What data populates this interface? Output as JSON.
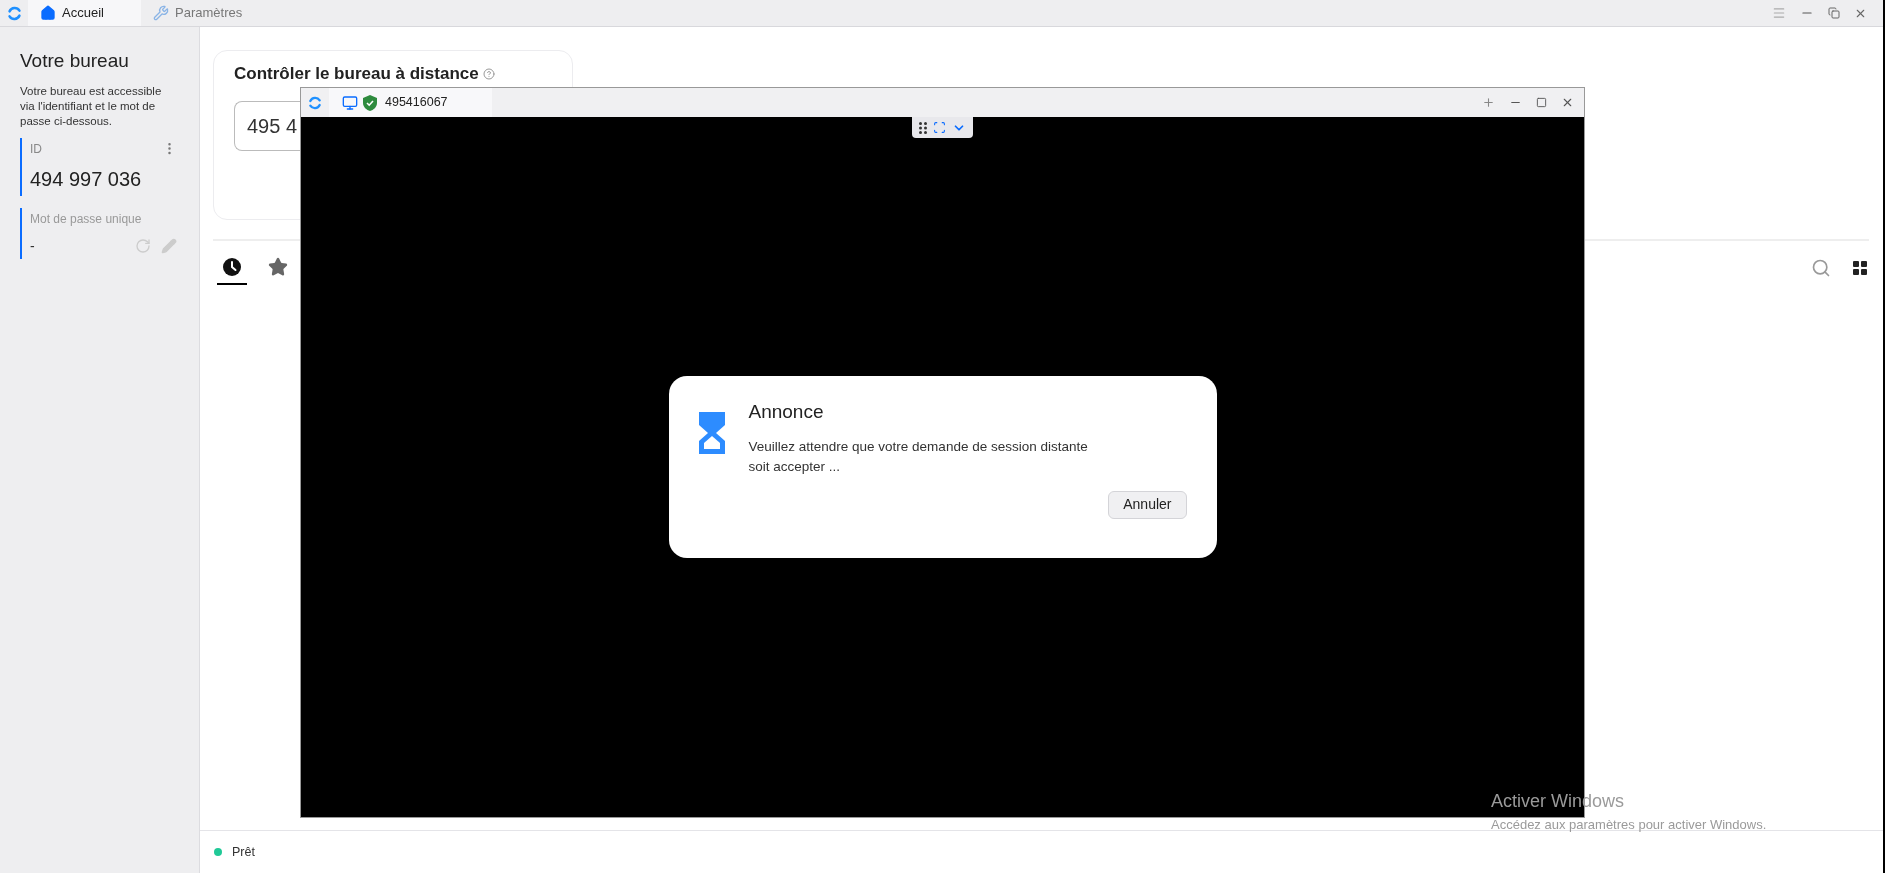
{
  "app_tabs": [
    {
      "label": "Accueil",
      "selected": true
    },
    {
      "label": "Paramètres",
      "selected": false
    }
  ],
  "sidebar": {
    "title": "Votre bureau",
    "description": "Votre bureau est accessible via l'identifiant et le mot de passe ci-dessous.",
    "id_label": "ID",
    "id_value": "494 997 036",
    "password_label": "Mot de passe unique",
    "password_value": "-"
  },
  "connect_card": {
    "title": "Contrôler le bureau à distance",
    "id_value": "495 4"
  },
  "peer_tabs": [
    {
      "kind": "recent",
      "selected": true
    },
    {
      "kind": "favorites",
      "selected": false
    }
  ],
  "status": {
    "text": "Prêt"
  },
  "remote_window": {
    "title": "495416067",
    "dialog": {
      "title": "Annonce",
      "message": "Veuillez attendre que votre demande de session distante soit accepter ...",
      "button": "Annuler"
    }
  },
  "os_notice": {
    "title": "Activer Windows",
    "subtitle": "Accédez aux paramètres pour activer Windows."
  }
}
